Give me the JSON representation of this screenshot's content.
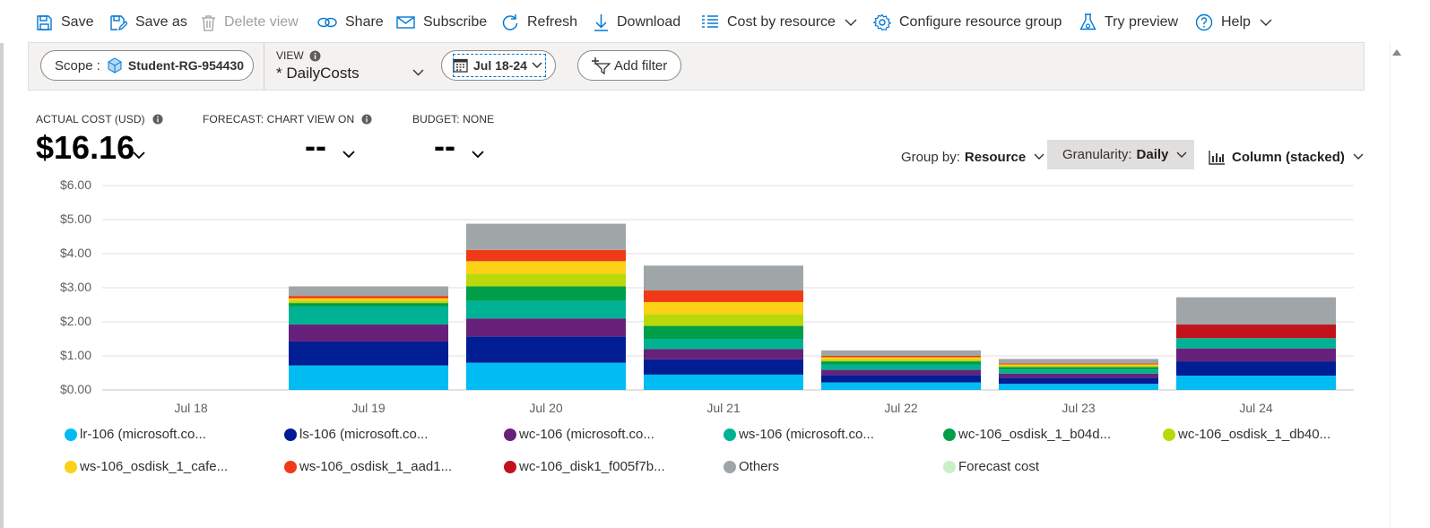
{
  "toolbar": {
    "save": "Save",
    "save_as": "Save as",
    "delete_view": "Delete view",
    "share": "Share",
    "subscribe": "Subscribe",
    "refresh": "Refresh",
    "download": "Download",
    "cost_by_resource": "Cost by resource",
    "configure_resource_group": "Configure resource group",
    "try_preview": "Try preview",
    "help": "Help"
  },
  "filters": {
    "scope_label": "Scope :",
    "scope_value": "Student-RG-954430",
    "view_label": "VIEW",
    "view_value": "* DailyCosts",
    "date_range": "Jul 18-24",
    "add_filter": "Add filter"
  },
  "kpis": {
    "actual_label": "ACTUAL COST (USD)",
    "actual_value": "$16.16",
    "forecast_label": "FORECAST: CHART VIEW ON",
    "forecast_value": "--",
    "budget_label": "BUDGET: NONE",
    "budget_value": "--"
  },
  "controls": {
    "group_by_label": "Group by:",
    "group_by_value": "Resource",
    "granularity_label": "Granularity:",
    "granularity_value": "Daily",
    "chart_type": "Column (stacked)"
  },
  "chart_data": {
    "type": "bar",
    "stacked": true,
    "categories": [
      "Jul 18",
      "Jul 19",
      "Jul 20",
      "Jul 21",
      "Jul 22",
      "Jul 23",
      "Jul 24"
    ],
    "y_ticks": [
      "$0.00",
      "$1.00",
      "$2.00",
      "$3.00",
      "$4.00",
      "$5.00",
      "$6.00"
    ],
    "ylim": [
      0,
      6
    ],
    "grid": true,
    "legend_position": "bottom",
    "series": [
      {
        "name": "lr-106 (microsoft.co...",
        "color": "#00bcf2",
        "values": [
          0,
          0.72,
          0.8,
          0.45,
          0.22,
          0.18,
          0.42
        ]
      },
      {
        "name": "ls-106 (microsoft.co...",
        "color": "#001d93",
        "values": [
          0,
          0.7,
          0.77,
          0.45,
          0.22,
          0.18,
          0.42
        ]
      },
      {
        "name": "wc-106 (microsoft.co...",
        "color": "#68217a",
        "values": [
          0,
          0.5,
          0.53,
          0.3,
          0.15,
          0.12,
          0.38
        ]
      },
      {
        "name": "ws-106 (microsoft.co...",
        "color": "#00b294",
        "values": [
          0,
          0.53,
          0.52,
          0.3,
          0.15,
          0.12,
          0.3
        ]
      },
      {
        "name": "wc-106_osdisk_1_b04d...",
        "color": "#009e49",
        "values": [
          0,
          0.1,
          0.42,
          0.38,
          0.1,
          0.07,
          0
        ]
      },
      {
        "name": "wc-106_osdisk_1_db40...",
        "color": "#bad80a",
        "values": [
          0,
          0.07,
          0.37,
          0.35,
          0.06,
          0.04,
          0
        ]
      },
      {
        "name": "ws-106_osdisk_1_cafe...",
        "color": "#fcd116",
        "values": [
          0,
          0.07,
          0.37,
          0.35,
          0.06,
          0.04,
          0
        ]
      },
      {
        "name": "ws-106_osdisk_1_aad1...",
        "color": "#f03a17",
        "values": [
          0,
          0.07,
          0.33,
          0.34,
          0.04,
          0.03,
          0
        ]
      },
      {
        "name": "wc-106_disk1_f005f7b...",
        "color": "#c1121c",
        "values": [
          0,
          0,
          0,
          0,
          0,
          0,
          0.4
        ]
      },
      {
        "name": "Others",
        "color": "#a0a5a8",
        "values": [
          0,
          0.28,
          0.77,
          0.73,
          0.16,
          0.13,
          0.8
        ]
      },
      {
        "name": "Forecast cost",
        "color": "#c8f0c8",
        "values": [
          0,
          0,
          0,
          0,
          0,
          0,
          0
        ]
      }
    ]
  }
}
